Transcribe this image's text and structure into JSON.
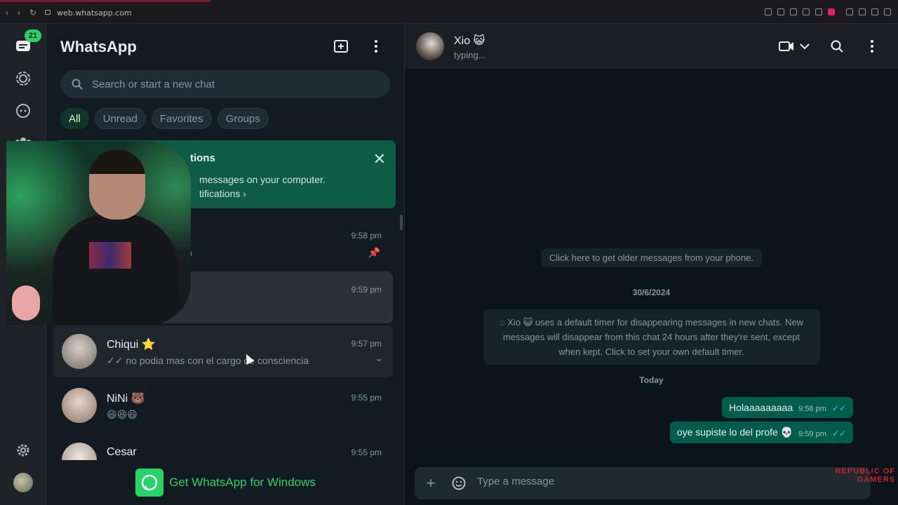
{
  "browser": {
    "url": "web.whatsapp.com"
  },
  "rail": {
    "unread_count": "21"
  },
  "side": {
    "title": "WhatsApp",
    "search_placeholder": "Search or start a new chat",
    "chips": [
      "All",
      "Unread",
      "Favorites",
      "Groups"
    ],
    "notification": {
      "title": "tions",
      "text": "messages on your computer.",
      "link": "tifications ›"
    },
    "chats": [
      {
        "name": "",
        "time": "9:58 pm",
        "preview": "n"
      },
      {
        "name": "",
        "time": "9:59 pm",
        "preview": ""
      },
      {
        "name": "Chiqui ⭐",
        "time": "9:57 pm",
        "preview": "✓✓ no podia mas con el cargo de consciencia"
      },
      {
        "name": "NiNi 🐻",
        "time": "9:55 pm",
        "preview": "😆😆😆"
      },
      {
        "name": "Cesar",
        "time": "9:55 pm",
        "preview": ""
      }
    ],
    "get_app": "Get WhatsApp for Windows"
  },
  "conversation": {
    "name": "Xio 😺",
    "status": "typing...",
    "older": "Click here to get older messages from your phone.",
    "date1": "30/6/2024",
    "timer_notice": "◌ Xio 😺 uses a default timer for disappearing messages in new chats. New messages will disappear from this chat 24 hours after they're sent, except when kept. Click to set your own default timer.",
    "date2": "Today",
    "messages": [
      {
        "text": "Holaaaaaaaaa",
        "time": "9:58 pm"
      },
      {
        "text": "oye supiste lo del profe 💀",
        "time": "9:59 pm"
      }
    ],
    "composer_placeholder": "Type a message",
    "watermark": "REPUBLIC OF GAMERS"
  },
  "colors": {
    "accent": "#25d366",
    "outgoing": "#005c4b",
    "banner": "#0f5c46"
  }
}
